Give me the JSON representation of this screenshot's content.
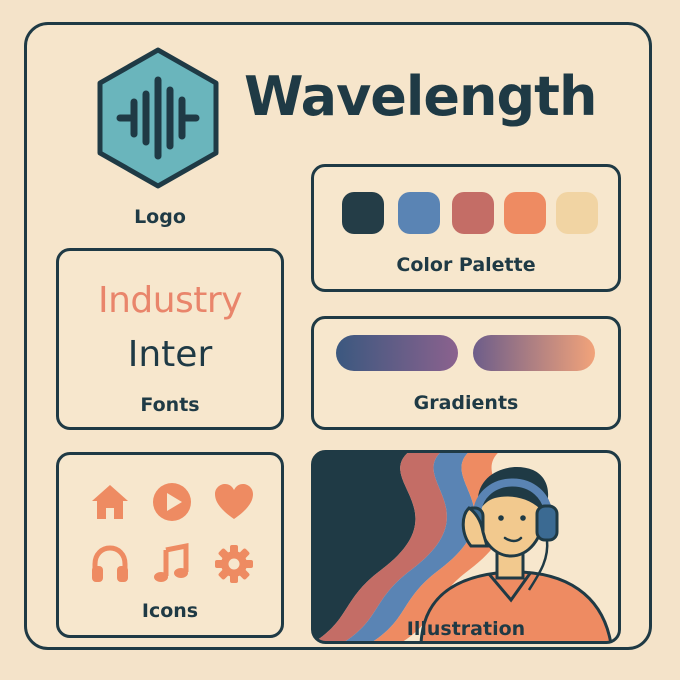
{
  "brand": {
    "name": "Wavelength",
    "logo_icon": "soundwave-hexagon-icon"
  },
  "sections": {
    "logo_label": "Logo",
    "palette_label": "Color Palette",
    "fonts_label": "Fonts",
    "gradients_label": "Gradients",
    "icons_label": "Icons",
    "illustration_label": "Illustration"
  },
  "fonts": {
    "display": "Industry",
    "body": "Inter"
  },
  "palette": [
    "#243d47",
    "#5a84b4",
    "#c46d66",
    "#ee8b62",
    "#f1d4a3"
  ],
  "gradients": [
    {
      "from": "#3b587f",
      "to": "#8b628e"
    },
    {
      "from": "#6d5d8a",
      "to": "#f2a37a"
    }
  ],
  "icons": [
    "home-icon",
    "play-icon",
    "heart-icon",
    "headphones-icon",
    "music-note-icon",
    "gear-icon"
  ],
  "colors": {
    "ink": "#1f3a45",
    "accent": "#e9856b",
    "teal": "#6ab5bc",
    "background": "#f4e3c9"
  }
}
